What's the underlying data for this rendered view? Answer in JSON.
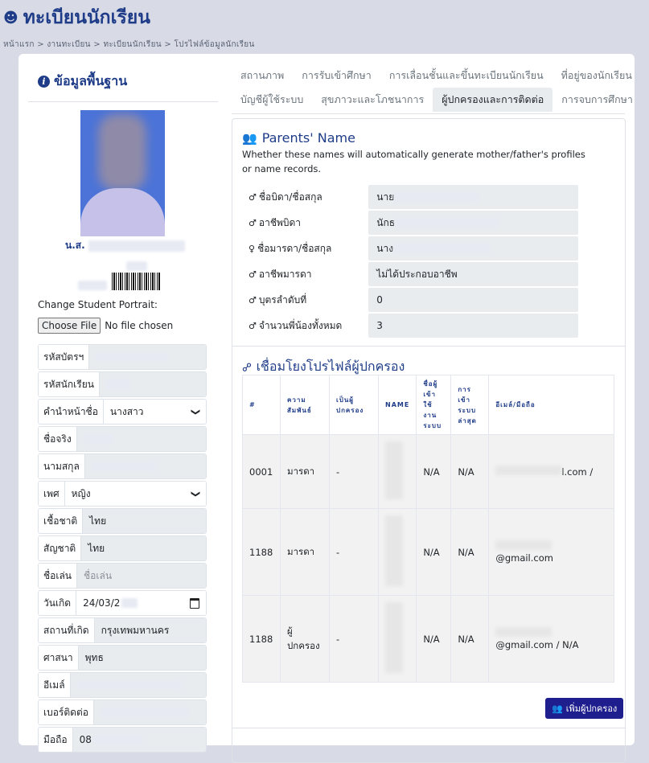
{
  "header": {
    "title": "ทะเบียนนักเรียน",
    "breadcrumb": [
      "หน้าแรก",
      "งานทะเบียน",
      "ทะเบียนนักเรียน",
      "โปรไฟล์ข้อมูลนักเรียน"
    ]
  },
  "left": {
    "heading": "ข้อมูลพื้นฐาน",
    "student_prefix_name": "น.ส.",
    "change_portrait_label": "Change Student Portrait:",
    "file_button": "Choose File",
    "file_status": "No file chosen",
    "fields": [
      {
        "label": "รหัสบัตรฯ",
        "value": ""
      },
      {
        "label": "รหัสนักเรียน",
        "value": ""
      },
      {
        "label": "คำนำหน้าชื่อ",
        "value": "นางสาว",
        "type": "select"
      },
      {
        "label": "ชื่อจริง",
        "value": ""
      },
      {
        "label": "นามสกุล",
        "value": ""
      },
      {
        "label": "เพศ",
        "value": "หญิง",
        "type": "select"
      },
      {
        "label": "เชื้อชาติ",
        "value": "ไทย"
      },
      {
        "label": "สัญชาติ",
        "value": "ไทย"
      },
      {
        "label": "ชื่อเล่น",
        "value": "",
        "placeholder": "ชื่อเล่น"
      },
      {
        "label": "วันเกิด",
        "value": "24/03/2",
        "type": "date"
      },
      {
        "label": "สถานที่เกิด",
        "value": "กรุงเทพมหานคร"
      },
      {
        "label": "ศาสนา",
        "value": "พุทธ"
      },
      {
        "label": "อีเมล์",
        "value": ""
      },
      {
        "label": "เบอร์ติดต่อ",
        "value": ""
      },
      {
        "label": "มือถือ",
        "value": "08"
      }
    ]
  },
  "tabs": {
    "row1": [
      "สถานภาพ",
      "การรับเข้าศึกษา",
      "การเลื่อนชั้นและขึ้นทะเบียนนักเรียน",
      "ที่อยู่ของนักเรียน"
    ],
    "row2": [
      "บัญชีผู้ใช้ระบบ",
      "สุขภาวะและโภชนาการ",
      "ผู้ปกครองและการติดต่อ",
      "การจบการศึกษา"
    ],
    "active": "ผู้ปกครองและการติดต่อ"
  },
  "parents": {
    "title": "Parents' Name",
    "description": "Whether these names will automatically generate mother/father's profiles or name records.",
    "rows": [
      {
        "label": "ชื่อบิดา/ชื่อสกุล",
        "value": "นาย"
      },
      {
        "label": "อาชีพบิดา",
        "value": "นักธ"
      },
      {
        "label": "ชื่อมารดา/ชื่อสกุล",
        "value": "นาง"
      },
      {
        "label": "อาชีพมารดา",
        "value": "ไม่ได้ประกอบอาชีพ"
      },
      {
        "label": "บุตรลำดับที่",
        "value": "0"
      },
      {
        "label": "จำนวนพี่น้องทั้งหมด",
        "value": "3"
      }
    ]
  },
  "guardian_link": {
    "title": "เชื่อมโยงโปรไฟล์ผู้ปกครอง",
    "columns": [
      "#",
      "ความสัมพันธ์",
      "เป็นผู้ปกครอง",
      "NAME",
      "ชื่อผู้เข้าใช้งานระบบ",
      "การเข้าระบบล่าสุด",
      "อีเมล์/มือถือ"
    ],
    "rows": [
      {
        "id": "0001",
        "relation": "มารดา",
        "is_guardian": "-",
        "username": "N/A",
        "last_login": "N/A",
        "contact": "l.com /"
      },
      {
        "id": "1188",
        "relation": "มารดา",
        "is_guardian": "-",
        "username": "N/A",
        "last_login": "N/A",
        "contact": "@gmail.com"
      },
      {
        "id": "1188",
        "relation": "ผู้ปกครอง",
        "is_guardian": "-",
        "username": "N/A",
        "last_login": "N/A",
        "contact": "@gmail.com / N/A"
      }
    ],
    "add_button": "เพิ่มผู้ปกครอง"
  }
}
